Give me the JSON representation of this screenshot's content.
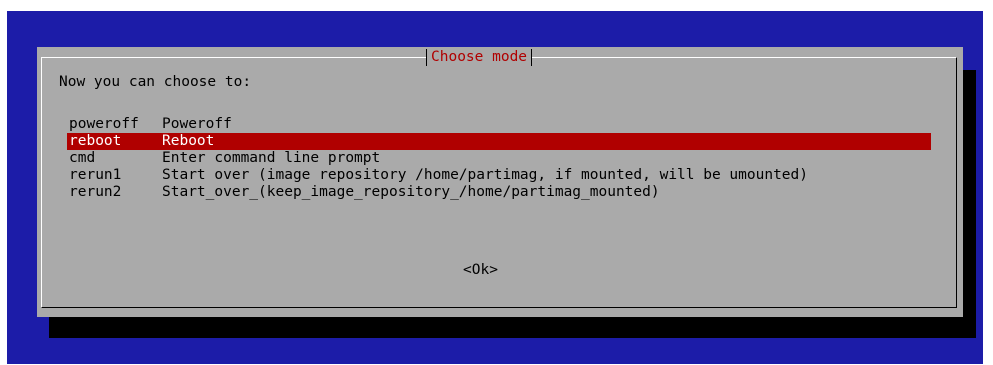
{
  "dialog": {
    "title": "Choose mode",
    "prompt": "Now you can choose to:",
    "items": [
      {
        "tag": "poweroff",
        "desc": "Poweroff",
        "selected": false
      },
      {
        "tag": "reboot",
        "desc": "Reboot",
        "selected": true
      },
      {
        "tag": "cmd",
        "desc": "Enter command line prompt",
        "selected": false
      },
      {
        "tag": "rerun1",
        "desc": "Start over (image repository /home/partimag, if mounted, will be umounted)",
        "selected": false
      },
      {
        "tag": "rerun2",
        "desc": "Start_over_(keep_image_repository_/home/partimag_mounted)",
        "selected": false
      }
    ],
    "ok_label": "<Ok>"
  },
  "colors": {
    "screen_background": "#1c1ca8",
    "dialog_background": "#aaaaaa",
    "highlight": "#b00000",
    "shadow": "#000000"
  }
}
